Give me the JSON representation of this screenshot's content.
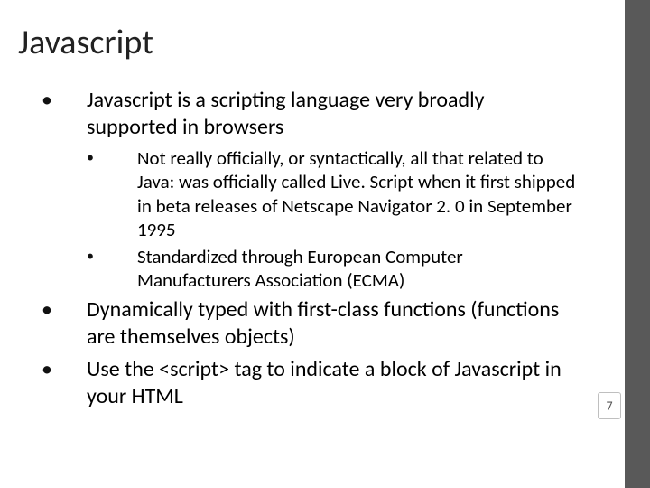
{
  "title": "Javascript",
  "bullets": {
    "b1": "Javascript is a scripting language very broadly supported in browsers",
    "b1a": "Not really officially, or syntactically, all that related to Java: was officially called Live. Script when it first shipped in beta releases of Netscape Navigator 2. 0 in September 1995",
    "b1b": "Standardized through European Computer Manufacturers Association (ECMA)",
    "b2": "Dynamically typed with first-class functions (functions are themselves objects)",
    "b3": "Use the <script> tag to indicate a block of Javascript in your HTML"
  },
  "page_number": "7"
}
